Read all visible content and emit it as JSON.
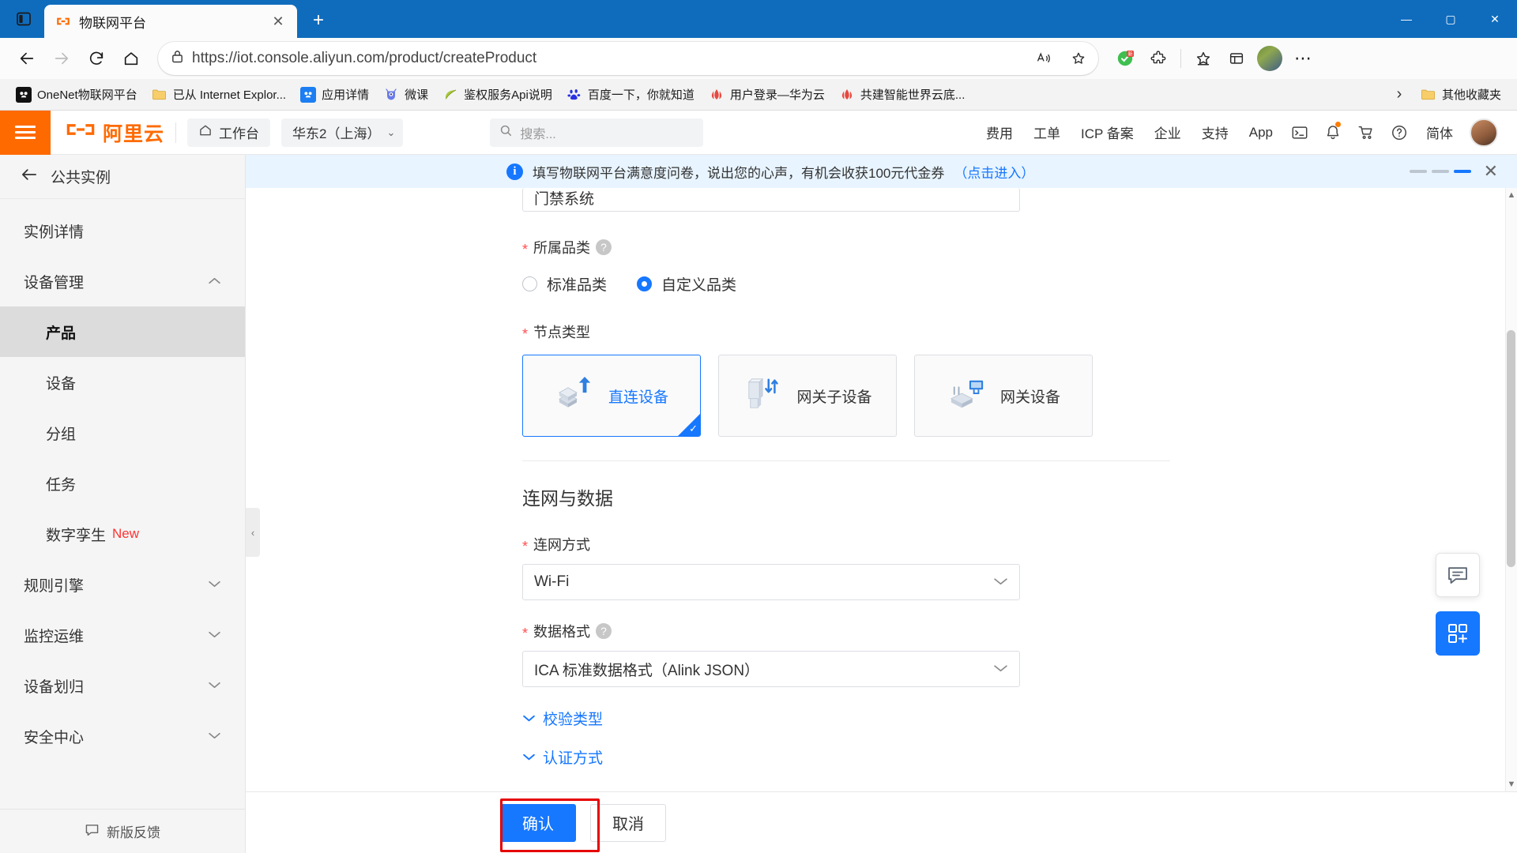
{
  "browser": {
    "tab": {
      "title": "物联网平台",
      "favicon": "aliyun-iot-icon",
      "close_label": "✕"
    },
    "newtab_label": "+",
    "window_controls": {
      "minimize": "—",
      "maximize": "▢",
      "close": "✕"
    },
    "toolbar": {
      "back": "←",
      "forward": "→",
      "reload": "⟳",
      "home": "⌂",
      "url_prefix": "https://",
      "url": "iot.console.aliyun.com/product/createProduct",
      "url_full": "https://iot.console.aliyun.com/product/createProduct",
      "read_aloud": "A))",
      "favorite": "☆",
      "collections": "▤",
      "settings": "⋯",
      "split_screen": "▥"
    },
    "bookmarks": [
      {
        "label": "OneNet物联网平台",
        "icon": "onenet-icon",
        "icon_color": "#111111"
      },
      {
        "label": "已从 Internet Explor...",
        "icon": "folder-icon",
        "icon_color": "#F2C063"
      },
      {
        "label": "应用详情",
        "icon": "app-icon",
        "icon_color": "#1C7EF2"
      },
      {
        "label": "微课",
        "icon": "weike-icon",
        "icon_color": "#6A7BE8"
      },
      {
        "label": "鉴权服务Api说明",
        "icon": "leaf-icon",
        "icon_color": "#A9C83A"
      },
      {
        "label": "百度一下，你就知道",
        "icon": "baidu-icon",
        "icon_color": "#2932E1"
      },
      {
        "label": "用户登录—华为云",
        "icon": "huawei-icon",
        "icon_color": "#E8483F"
      },
      {
        "label": "共建智能世界云底...",
        "icon": "huawei-icon",
        "icon_color": "#E8483F"
      }
    ],
    "bookmarks_overflow": "›",
    "other_favorites": {
      "label": "其他收藏夹",
      "icon": "folder-icon"
    }
  },
  "console_header": {
    "menu_icon": "hamburger-icon",
    "logo_text": "阿里云",
    "workbench": {
      "label": "工作台",
      "icon": "home-icon"
    },
    "region": {
      "label": "华东2（上海）",
      "chevron": "⌄"
    },
    "search": {
      "placeholder": "搜索...",
      "icon": "search-icon"
    },
    "nav": [
      "费用",
      "工单",
      "ICP 备案",
      "企业",
      "支持",
      "App"
    ],
    "icons": [
      "terminal-icon",
      "bell-icon",
      "cart-icon",
      "help-icon"
    ],
    "language": "简体",
    "avatar": "user-avatar"
  },
  "sidebar": {
    "back": {
      "label": "公共实例",
      "icon": "arrow-left-icon"
    },
    "items": [
      {
        "label": "实例详情",
        "level": 0,
        "active": false,
        "chevron": ""
      },
      {
        "label": "设备管理",
        "level": 0,
        "active": false,
        "chevron": "⌃"
      },
      {
        "label": "产品",
        "level": 1,
        "active": true,
        "chevron": ""
      },
      {
        "label": "设备",
        "level": 1,
        "active": false,
        "chevron": ""
      },
      {
        "label": "分组",
        "level": 1,
        "active": false,
        "chevron": ""
      },
      {
        "label": "任务",
        "level": 1,
        "active": false,
        "chevron": ""
      },
      {
        "label": "数字孪生",
        "level": 1,
        "active": false,
        "chevron": "",
        "badge": "New"
      },
      {
        "label": "规则引擎",
        "level": 0,
        "active": false,
        "chevron": "⌄"
      },
      {
        "label": "监控运维",
        "level": 0,
        "active": false,
        "chevron": "⌄"
      },
      {
        "label": "设备划归",
        "level": 0,
        "active": false,
        "chevron": "⌄"
      },
      {
        "label": "安全中心",
        "level": 0,
        "active": false,
        "chevron": "⌄"
      }
    ],
    "footer": {
      "label": "新版反馈",
      "icon": "feedback-icon"
    }
  },
  "notice": {
    "icon": "info-icon",
    "text": "填写物联网平台满意度问卷，说出您的心声，有机会收获100元代金券",
    "link": "（点击进入）",
    "close": "✕"
  },
  "form": {
    "product_name_value": "门禁系统",
    "category": {
      "label": "所属品类",
      "required": "*",
      "help": "?",
      "options": [
        {
          "label": "标准品类",
          "selected": false
        },
        {
          "label": "自定义品类",
          "selected": true
        }
      ]
    },
    "node_type": {
      "label": "节点类型",
      "required": "*",
      "cards": [
        {
          "label": "直连设备",
          "icon": "direct-device-icon",
          "selected": true
        },
        {
          "label": "网关子设备",
          "icon": "gateway-subdevice-icon",
          "selected": false
        },
        {
          "label": "网关设备",
          "icon": "gateway-device-icon",
          "selected": false
        }
      ],
      "check_mark": "✓"
    },
    "section_network": {
      "title": "连网与数据"
    },
    "network_mode": {
      "label": "连网方式",
      "required": "*",
      "value": "Wi-Fi",
      "chevron": "⌄"
    },
    "data_format": {
      "label": "数据格式",
      "required": "*",
      "help": "?",
      "value": "ICA 标准数据格式（Alink JSON）",
      "chevron": "⌄"
    },
    "collapse_verify": {
      "label": "校验类型",
      "chevron": "⌄"
    },
    "collapse_auth": {
      "label": "认证方式",
      "chevron": "⌄"
    }
  },
  "footer_actions": {
    "confirm": "确认",
    "cancel": "取消"
  },
  "float_widgets": {
    "chat": "chat-icon",
    "grid": "apps-grid-icon"
  },
  "colors": {
    "brand_orange": "#FF6A00",
    "primary_blue": "#1677FF",
    "browser_blue": "#0F6CBD",
    "highlight_red": "#E60000",
    "new_badge_red": "#FF3333"
  },
  "scroll": {
    "up": "▲",
    "down": "▼"
  },
  "collapse_panel": {
    "chevron": "‹"
  }
}
